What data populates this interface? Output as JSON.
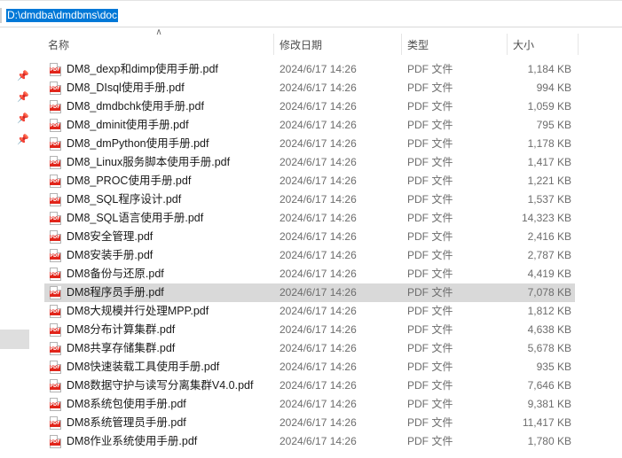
{
  "address_bar": {
    "path": "D:\\dmdba\\dmdbms\\doc"
  },
  "columns": {
    "name": "名称",
    "date": "修改日期",
    "type": "类型",
    "size": "大小"
  },
  "files": [
    {
      "name": "DM8_dexp和dimp使用手册.pdf",
      "date": "2024/6/17 14:26",
      "type": "PDF 文件",
      "size": "1,184 KB"
    },
    {
      "name": "DM8_DIsql使用手册.pdf",
      "date": "2024/6/17 14:26",
      "type": "PDF 文件",
      "size": "994 KB"
    },
    {
      "name": "DM8_dmdbchk使用手册.pdf",
      "date": "2024/6/17 14:26",
      "type": "PDF 文件",
      "size": "1,059 KB"
    },
    {
      "name": "DM8_dminit使用手册.pdf",
      "date": "2024/6/17 14:26",
      "type": "PDF 文件",
      "size": "795 KB"
    },
    {
      "name": "DM8_dmPython使用手册.pdf",
      "date": "2024/6/17 14:26",
      "type": "PDF 文件",
      "size": "1,178 KB"
    },
    {
      "name": "DM8_Linux服务脚本使用手册.pdf",
      "date": "2024/6/17 14:26",
      "type": "PDF 文件",
      "size": "1,417 KB"
    },
    {
      "name": "DM8_PROC使用手册.pdf",
      "date": "2024/6/17 14:26",
      "type": "PDF 文件",
      "size": "1,221 KB"
    },
    {
      "name": "DM8_SQL程序设计.pdf",
      "date": "2024/6/17 14:26",
      "type": "PDF 文件",
      "size": "1,537 KB"
    },
    {
      "name": "DM8_SQL语言使用手册.pdf",
      "date": "2024/6/17 14:26",
      "type": "PDF 文件",
      "size": "14,323 KB"
    },
    {
      "name": "DM8安全管理.pdf",
      "date": "2024/6/17 14:26",
      "type": "PDF 文件",
      "size": "2,416 KB"
    },
    {
      "name": "DM8安装手册.pdf",
      "date": "2024/6/17 14:26",
      "type": "PDF 文件",
      "size": "2,787 KB"
    },
    {
      "name": "DM8备份与还原.pdf",
      "date": "2024/6/17 14:26",
      "type": "PDF 文件",
      "size": "4,419 KB"
    },
    {
      "name": "DM8程序员手册.pdf",
      "date": "2024/6/17 14:26",
      "type": "PDF 文件",
      "size": "7,078 KB",
      "selected": true
    },
    {
      "name": "DM8大规模并行处理MPP.pdf",
      "date": "2024/6/17 14:26",
      "type": "PDF 文件",
      "size": "1,812 KB"
    },
    {
      "name": "DM8分布计算集群.pdf",
      "date": "2024/6/17 14:26",
      "type": "PDF 文件",
      "size": "4,638 KB"
    },
    {
      "name": "DM8共享存储集群.pdf",
      "date": "2024/6/17 14:26",
      "type": "PDF 文件",
      "size": "5,678 KB"
    },
    {
      "name": "DM8快速装载工具使用手册.pdf",
      "date": "2024/6/17 14:26",
      "type": "PDF 文件",
      "size": "935 KB"
    },
    {
      "name": "DM8数据守护与读写分离集群V4.0.pdf",
      "date": "2024/6/17 14:26",
      "type": "PDF 文件",
      "size": "7,646 KB"
    },
    {
      "name": "DM8系统包使用手册.pdf",
      "date": "2024/6/17 14:26",
      "type": "PDF 文件",
      "size": "9,381 KB"
    },
    {
      "name": "DM8系统管理员手册.pdf",
      "date": "2024/6/17 14:26",
      "type": "PDF 文件",
      "size": "11,417 KB"
    },
    {
      "name": "DM8作业系统使用手册.pdf",
      "date": "2024/6/17 14:26",
      "type": "PDF 文件",
      "size": "1,780 KB"
    }
  ],
  "icons": {
    "file": "pdf-file-icon",
    "pin": "pin-icon",
    "sort": "sort-ascending-icon"
  },
  "colors": {
    "selection": "#d9d9d9",
    "address_highlight": "#0078d7",
    "pdf_red": "#e1251b"
  }
}
